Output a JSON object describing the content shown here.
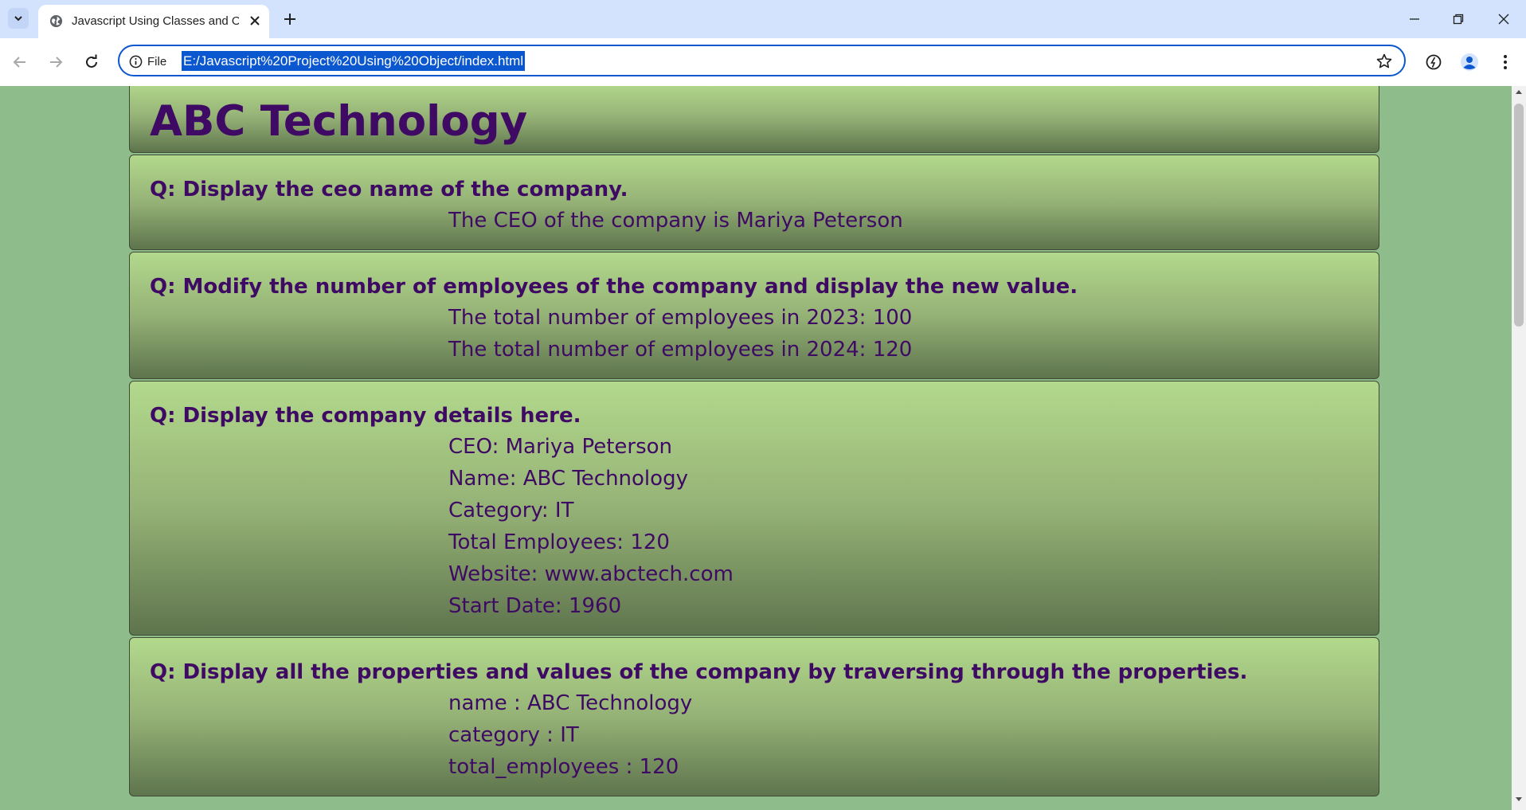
{
  "browser": {
    "tab_title": "Javascript Using Classes and Objects",
    "site_info_label": "File",
    "url": "E:/Javascript%20Project%20Using%20Object/index.html"
  },
  "page": {
    "heading": "ABC Technology",
    "sections": [
      {
        "question": "Q: Display the ceo name of the company.",
        "answers": [
          "The CEO of the company is Mariya Peterson"
        ]
      },
      {
        "question": "Q: Modify the number of employees of the company and display the new value.",
        "answers": [
          "The total number of employees in 2023: 100",
          "The total number of employees in 2024: 120"
        ]
      },
      {
        "question": "Q: Display the company details here.",
        "answers": [
          "CEO: Mariya Peterson",
          "Name: ABC Technology",
          "Category: IT",
          "Total Employees: 120",
          "Website: www.abctech.com",
          "Start Date: 1960"
        ]
      },
      {
        "question": "Q: Display all the properties and values of the company by traversing through the properties.",
        "answers": [
          "name : ABC Technology",
          "category : IT",
          "total_employees : 120"
        ]
      }
    ]
  },
  "colors": {
    "page_background": "#8fbc8b",
    "text": "#3f0a63",
    "box_gradient_top": "#b2d98c",
    "box_gradient_bottom": "#5e744d",
    "url_highlight": "#0b57d0"
  }
}
